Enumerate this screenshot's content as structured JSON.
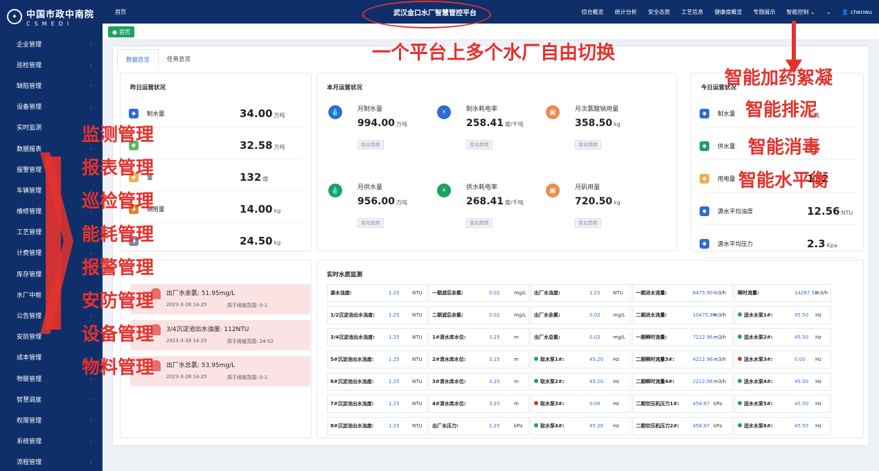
{
  "colors": {
    "navy": "#0f2f6b",
    "accent": "#2e6bd6",
    "green": "#1aa260",
    "annotation_red": "#e5322d",
    "annotation_blue": "#2a46c8"
  },
  "logo": {
    "cn": "中国市政中南院",
    "en": "CSMEDI"
  },
  "sidebar": {
    "items": [
      "企业管理",
      "巡检管理",
      "缺陷管理",
      "设备管理",
      "实时监测",
      "数据报表",
      "报警管理",
      "车辆管理",
      "维修管理",
      "工艺管理",
      "计费管理",
      "库存管理",
      "水厂中枢",
      "公告管理",
      "安防管理",
      "成本管理",
      "物联管理",
      "智慧调度",
      "权限管理",
      "系统管理",
      "流程管理"
    ]
  },
  "topbar": {
    "home": "首页",
    "platform_title": "武汉金口水厂智慧管控平台",
    "nav": [
      "综合概览",
      "统计分析",
      "安全态势",
      "工艺信息",
      "健康度概览",
      "专题展示",
      "智能控制 ⌄",
      "⌄"
    ],
    "user": "chenwu"
  },
  "tagbar": {
    "home_tag": "首页"
  },
  "tabs": [
    "数据总览",
    "任务总览"
  ],
  "yesterday": {
    "title": "昨日运营状况",
    "rows": [
      {
        "label": "制水量",
        "value": "34.00",
        "unit": "万吨"
      },
      {
        "label": "",
        "value": "32.58",
        "unit": "万吨"
      },
      {
        "label": "量",
        "value": "132",
        "unit": "度"
      },
      {
        "label": "钠用量",
        "value": "14.00",
        "unit": "kg"
      },
      {
        "label": "",
        "value": "24.50",
        "unit": "kg"
      }
    ]
  },
  "month": {
    "title": "本月运营状况",
    "items": [
      {
        "label": "月制水量",
        "value": "994.00",
        "unit": "万吨",
        "trend": "变化趋势"
      },
      {
        "label": "制水耗电率",
        "value": "258.41",
        "unit": "度/千吨",
        "trend": "变化趋势"
      },
      {
        "label": "月次氯酸钠用量",
        "value": "358.50",
        "unit": "kg",
        "trend": "变化趋势"
      },
      {
        "label": "月供水量",
        "value": "956.00",
        "unit": "万吨",
        "trend": "变化趋势"
      },
      {
        "label": "供水耗电率",
        "value": "268.41",
        "unit": "度/千吨",
        "trend": "变化趋势"
      },
      {
        "label": "月矾用量",
        "value": "720.50",
        "unit": "kg",
        "trend": "变化趋势"
      }
    ]
  },
  "today": {
    "title": "今日运营状况",
    "rows": [
      {
        "label": "制水量",
        "value": "",
        "unit": "万吨"
      },
      {
        "label": "供水量",
        "value": "",
        "unit": "万吨"
      },
      {
        "label": "用电量",
        "value": "132",
        "unit": ""
      },
      {
        "label": "源水平均浊度",
        "value": "12.56",
        "unit": "NTU"
      },
      {
        "label": "源水平均压力",
        "value": "2.3",
        "unit": "Kpa"
      }
    ]
  },
  "alarms": [
    {
      "title": "出厂水余氯: 51.95mg/L",
      "time": "2023-3-28 14:25",
      "range": "高于阈值范围: 0-1"
    },
    {
      "title": "3/4沉淀池出水浊度: 112NTU",
      "time": "2023-3-28 14:25",
      "range": "高于阈值范围: 24-52"
    },
    {
      "title": "出厂水总氯: 53.95mg/L",
      "time": "2023-3-28 14:25",
      "range": "高于阈值范围: 0-1"
    }
  ],
  "water_quality": {
    "title": "实时水质监测",
    "rows": [
      [
        {
          "n": "源水浊度:",
          "v": "1.25",
          "u": "NTU"
        },
        {
          "n": "一期滤后余氯:",
          "v": "0.02",
          "u": "mg/L"
        },
        {
          "n": "出厂水浊度:",
          "v": "1.25",
          "u": "NTU"
        },
        {
          "n": "一期进水流量:",
          "v": "8475.90",
          "u": "m3/h"
        },
        {
          "n": "瞬时流量:",
          "v": "14287.50",
          "u": "m3/h"
        }
      ],
      [
        {
          "n": "1/2沉淀池出水浊度:",
          "v": "1.25",
          "u": "NTU"
        },
        {
          "n": "二期滤后余氯:",
          "v": "0.02",
          "u": "mg/L"
        },
        {
          "n": "出厂水余氯:",
          "v": "0.02",
          "u": "mg/L"
        },
        {
          "n": "二期进水流量:",
          "v": "10475.90",
          "u": "m3/h"
        },
        {
          "n": "送水水泵1#:",
          "v": "45.50",
          "u": "Hz",
          "dot": "#1aa260"
        }
      ],
      [
        {
          "n": "3/4沉淀池出水浊度:",
          "v": "1.25",
          "u": "NTU"
        },
        {
          "n": "1#清水库水位:",
          "v": "3.25",
          "u": "m"
        },
        {
          "n": "出厂水总氯:",
          "v": "0.02",
          "u": "mg/L"
        },
        {
          "n": "一期瞬时流量:",
          "v": "7212.96",
          "u": "m3/h"
        },
        {
          "n": "送水水泵2#:",
          "v": "45.50",
          "u": "Hz",
          "dot": "#1aa260"
        }
      ],
      [
        {
          "n": "5#沉淀池出水浊度:",
          "v": "1.25",
          "u": "NTU"
        },
        {
          "n": "2#清水库水位:",
          "v": "3.25",
          "u": "m"
        },
        {
          "n": "取水泵1#:",
          "v": "45.20",
          "u": "Hz",
          "dot": "#1aa260"
        },
        {
          "n": "二期瞬时流量3#:",
          "v": "4212.96",
          "u": "m3/h"
        },
        {
          "n": "送水水泵3#:",
          "v": "0.00",
          "u": "Hz",
          "dot": "#d9342b"
        }
      ],
      [
        {
          "n": "6#沉淀池出水浊度:",
          "v": "1.25",
          "u": "NTU"
        },
        {
          "n": "3#清水库水位:",
          "v": "3.25",
          "u": "m"
        },
        {
          "n": "取水泵2#:",
          "v": "45.20",
          "u": "Hz",
          "dot": "#1aa260"
        },
        {
          "n": "二期瞬时流量4#:",
          "v": "2212.96",
          "u": "m3/h"
        },
        {
          "n": "送水水泵4#:",
          "v": "45.50",
          "u": "Hz",
          "dot": "#1aa260"
        }
      ],
      [
        {
          "n": "7#沉淀池出水浊度:",
          "v": "1.25",
          "u": "NTU"
        },
        {
          "n": "4#清水库水位:",
          "v": "3.25",
          "u": "m"
        },
        {
          "n": "取水泵3#:",
          "v": "0.00",
          "u": "Hz",
          "dot": "#d9342b"
        },
        {
          "n": "二期空压机压力1#:",
          "v": "458.87",
          "u": "kPa"
        },
        {
          "n": "送水水泵5#:",
          "v": "45.50",
          "u": "Hz",
          "dot": "#1aa260"
        }
      ],
      [
        {
          "n": "8#沉淀池出水浊度:",
          "v": "1.25",
          "u": "NTU"
        },
        {
          "n": "出厂水压力:",
          "v": "1.25",
          "u": "kPa"
        },
        {
          "n": "取水泵4#:",
          "v": "45.20",
          "u": "Hz",
          "dot": "#1aa260"
        },
        {
          "n": "二期空压机压力2#:",
          "v": "458.87",
          "u": "kPa"
        },
        {
          "n": "送水水泵6#:",
          "v": "45.50",
          "u": "Hz",
          "dot": "#1aa260"
        }
      ]
    ]
  },
  "annotations": {
    "platform_switch": "一个平台上多个水厂自由切换",
    "left_list": [
      "监测管理",
      "报表管理",
      "巡检管理",
      "能耗管理",
      "报警管理",
      "安防管理",
      "设备管理",
      "物料管理"
    ],
    "right_list": [
      "智能加药絮凝",
      "智能排泥",
      "智能消毒",
      "智能水平衡"
    ]
  }
}
